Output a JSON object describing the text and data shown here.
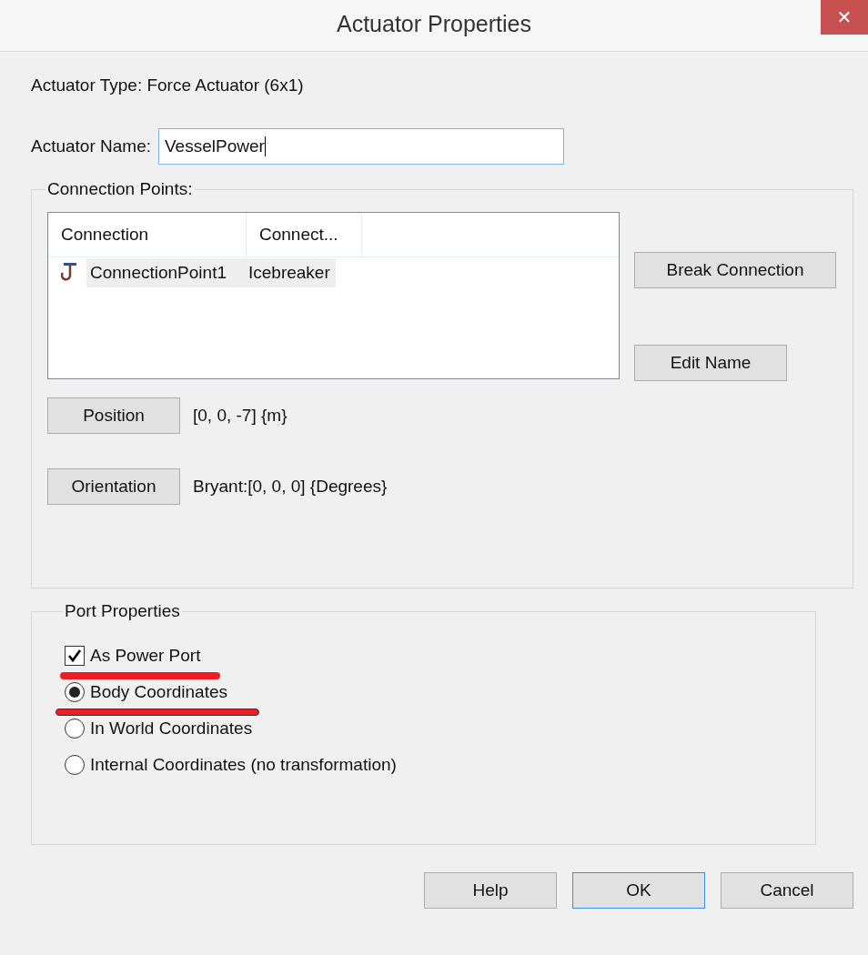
{
  "window": {
    "title": "Actuator Properties",
    "close": "✕"
  },
  "actuator_type": "Actuator Type: Force Actuator (6x1)",
  "name_field": {
    "label": "Actuator Name:",
    "value": "VesselPower"
  },
  "connection_points": {
    "title": "Connection Points:",
    "columns": [
      "Connection",
      "Connect..."
    ],
    "rows": [
      {
        "connection": "ConnectionPoint1",
        "connected_to": "Icebreaker",
        "selected": true
      }
    ],
    "break_button": "Break Connection",
    "edit_button": "Edit Name",
    "position": {
      "button": "Position",
      "value": "[0, 0, -7] {m}"
    },
    "orientation": {
      "button": "Orientation",
      "value": "Bryant:[0, 0, 0] {Degrees}"
    }
  },
  "port_properties": {
    "title": "Port Properties",
    "options": [
      {
        "kind": "checkbox",
        "label": "As Power Port",
        "checked": true,
        "highlighted": true
      },
      {
        "kind": "radio",
        "label": "Body Coordinates",
        "selected": true,
        "highlighted": true
      },
      {
        "kind": "radio",
        "label": "In World Coordinates",
        "selected": false,
        "highlighted": false
      },
      {
        "kind": "radio",
        "label": "Internal Coordinates (no transformation)",
        "selected": false,
        "highlighted": false
      }
    ]
  },
  "buttons": [
    {
      "label": "Help",
      "default": false
    },
    {
      "label": "OK",
      "default": true
    },
    {
      "label": "Cancel",
      "default": false
    }
  ]
}
